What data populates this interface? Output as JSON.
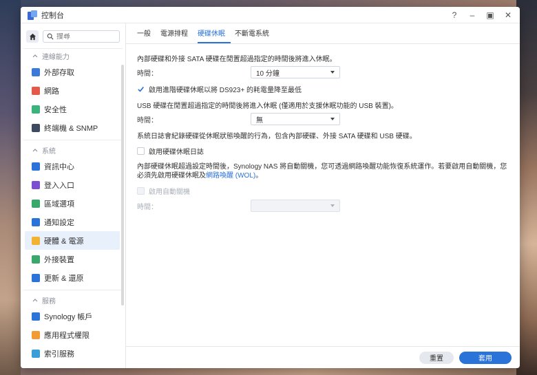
{
  "window": {
    "title": "控制台"
  },
  "controls": {
    "help": "?",
    "minimize": "–",
    "maximize": "▣",
    "close": "✕"
  },
  "sidebar": {
    "search_placeholder": "搜尋",
    "sections": [
      {
        "label": "連線能力",
        "items": [
          {
            "label": "外部存取",
            "color": "#3b7ad9"
          },
          {
            "label": "網路",
            "color": "#e25b4a"
          },
          {
            "label": "安全性",
            "color": "#3ab47a"
          },
          {
            "label": "終端機 & SNMP",
            "color": "#3d4a60"
          }
        ]
      },
      {
        "label": "系統",
        "items": [
          {
            "label": "資訊中心",
            "color": "#2a73d9"
          },
          {
            "label": "登入入口",
            "color": "#7b4fd0"
          },
          {
            "label": "區域選項",
            "color": "#3aa86a"
          },
          {
            "label": "通知設定",
            "color": "#2a73d9"
          },
          {
            "label": "硬體 & 電源",
            "color": "#f2b233"
          },
          {
            "label": "外接裝置",
            "color": "#3aa86a"
          },
          {
            "label": "更新 & 還原",
            "color": "#2a73d9"
          }
        ]
      },
      {
        "label": "服務",
        "items": [
          {
            "label": "Synology 帳戶",
            "color": "#2a73d9"
          },
          {
            "label": "應用程式權限",
            "color": "#f29a33"
          },
          {
            "label": "索引服務",
            "color": "#3a9fd9"
          }
        ]
      }
    ]
  },
  "tabs": [
    "一般",
    "電源排程",
    "硬碟休眠",
    "不斷電系統"
  ],
  "content": {
    "p1": "內部硬碟和外接 SATA 硬碟在閒置超過指定的時間後將進入休眠。",
    "time_label": "時間：",
    "time1_value": "10 分鐘",
    "cb1_label": "啟用進階硬碟休眠以將 DS923+ 的耗電量降至最低",
    "p2": "USB 硬碟在閒置超過指定的時間後將進入休眠 (僅適用於支援休眠功能的 USB 裝置)。",
    "time2_value": "無",
    "p3": "系統日誌會紀錄硬碟從休眠狀態喚醒的行為，包含內部硬碟、外接 SATA 硬碟和 USB 硬碟。",
    "cb2_label": "啟用硬碟休眠日誌",
    "p4_a": "內部硬碟休眠超過設定時間後，Synology NAS 將自動關機，您可透過網路喚醒功能恢復系統運作。若要啟用自動關機，您必須先啟用硬碟休眠及",
    "p4_link": "網路喚醒 (WOL)",
    "p4_end": "。",
    "cb3_label": "啟用自動關機",
    "time3_label": "時間："
  },
  "footer": {
    "reset": "重置",
    "apply": "套用"
  },
  "colors": {
    "accent": "#2a73d9"
  }
}
